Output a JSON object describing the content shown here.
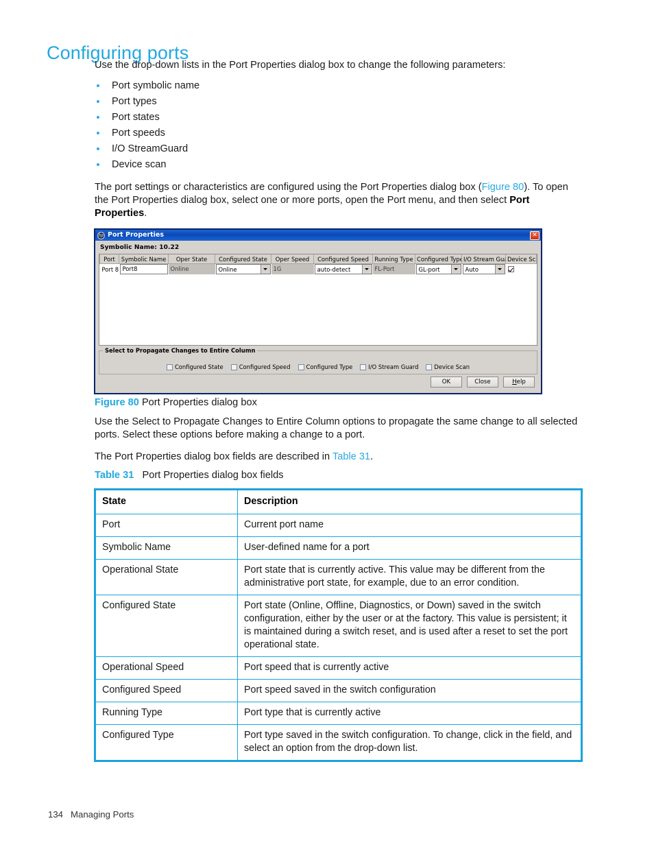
{
  "heading": "Configuring ports",
  "intro": "Use the drop-down lists in the Port Properties dialog box to change the following parameters:",
  "bullets": [
    "Port symbolic name",
    "Port types",
    "Port states",
    "Port speeds",
    "I/O StreamGuard",
    "Device scan"
  ],
  "para_figure": {
    "part1": "The port settings or characteristics are configured using the Port Properties dialog box (",
    "xref": "Figure 80",
    "part2": "). To open the Port Properties dialog box, select one or more ports, open the Port menu, and then select ",
    "bold": "Port Properties",
    "part3": "."
  },
  "dialog": {
    "title": "Port Properties",
    "icon": "hp-logo-icon",
    "close_label": "✕",
    "symbolic_name_line": "Symbolic Name: 10.22",
    "columns": [
      "Port",
      "Symbolic Name",
      "Oper State",
      "Configured State",
      "Oper Speed",
      "Configured Speed",
      "Running Type",
      "Configured Type",
      "I/O Stream Guard",
      "Device Scan"
    ],
    "row": {
      "port": "Port 8",
      "symbolic_name": "Port8",
      "oper_state": "Online",
      "configured_state": "Online",
      "oper_speed": "1G",
      "configured_speed": "auto-detect",
      "running_type": "FL-Port",
      "configured_type": "GL-port",
      "io_stream_guard": "Auto",
      "device_scan_checked": true
    },
    "propagate": {
      "legend": "Select to Propagate Changes to Entire Column",
      "options": [
        "Configured State",
        "Configured Speed",
        "Configured Type",
        "I/O Stream Guard",
        "Device Scan"
      ]
    },
    "buttons": {
      "ok": "OK",
      "close": "Close",
      "help_prefix": "H",
      "help_rest": "elp"
    }
  },
  "figure_caption": {
    "label": "Figure 80",
    "text": "Port Properties dialog box"
  },
  "para_propagate": "Use the Select to Propagate Changes to Entire Column options to propagate the same change to all selected ports. Select these options before making a change to a port.",
  "para_table_ref": {
    "part1": "The Port Properties dialog box fields are described in ",
    "xref": "Table 31",
    "part2": "."
  },
  "table_caption": {
    "label": "Table 31",
    "text": "Port Properties dialog box fields"
  },
  "fields_table": {
    "headers": [
      "State",
      "Description"
    ],
    "rows": [
      {
        "state": "Port",
        "description": "Current port name"
      },
      {
        "state": "Symbolic Name",
        "description": "User-defined name for a port"
      },
      {
        "state": "Operational State",
        "description": "Port state that is currently active. This value may be different from the administrative port state, for example, due to an error condition."
      },
      {
        "state": "Configured State",
        "description": "Port state (Online, Offline, Diagnostics, or Down) saved in the switch configuration, either by the user or at the factory. This value is persistent; it is maintained during a switch reset, and is used after a reset to set the port operational state."
      },
      {
        "state": "Operational Speed",
        "description": "Port speed that is currently active"
      },
      {
        "state": "Configured Speed",
        "description": "Port speed saved in the switch configuration"
      },
      {
        "state": "Running Type",
        "description": "Port type that is currently active"
      },
      {
        "state": "Configured Type",
        "description": "Port type saved in the switch configuration. To change, click in the field, and select an option from the drop-down list."
      }
    ]
  },
  "footer": {
    "page_number": "134",
    "section": "Managing Ports"
  },
  "colors": {
    "accent": "#23a8e0",
    "table_border": "#1aa3dd",
    "titlebar": "#0a48b5"
  }
}
